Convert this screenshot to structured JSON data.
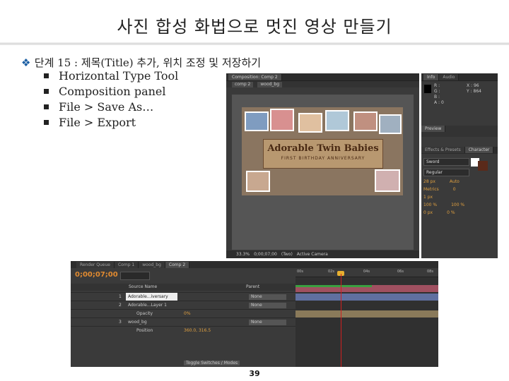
{
  "slide": {
    "title": "사진 합성 화법으로 멋진 영상 만들기",
    "step": "단계 15 : 제목(Title) 추가, 위치 조정 및 저장하기",
    "bullets": [
      "Horizontal Type Tool",
      "Composition panel",
      "File > Save As…",
      "File > Export"
    ],
    "page_number": "39"
  },
  "composition_panel": {
    "tab": "Composition: Comp 2",
    "crumbs": [
      "comp 2",
      "wood_bg"
    ],
    "canvas_title": "Adorable Twin Babies",
    "canvas_subtitle": "FIRST BIRTHDAY ANNIVERSARY",
    "zoom": "33.3%",
    "timecode": "0;00;07;00",
    "resolution": "(Two)",
    "camera": "Active Camera"
  },
  "info_panel": {
    "tabs": [
      "Info",
      "Audio"
    ],
    "rgba": [
      "R :",
      "G :",
      "B :",
      "A : 0"
    ],
    "xy": [
      "X : 96",
      "Y : 864"
    ],
    "preview_tab": "Preview",
    "effects_tab": "Effects & Presets",
    "character_tab": "Character",
    "font": "Sword",
    "style": "Regular",
    "size": "28 px",
    "tracking_value": "0",
    "auto": "Auto",
    "metric": "Metrics",
    "stroke": "1 px",
    "scale_v": "100 %",
    "scale_h": "100 %",
    "baseline": "0 px",
    "tsume": "0 %"
  },
  "timeline": {
    "tabs": [
      "Render Queue",
      "Comp 1",
      "wood_bg",
      "Comp 2"
    ],
    "timecode": "0;00;07;00",
    "header_name": "Source Name",
    "header_parent": "Parent",
    "layers": [
      {
        "num": "1",
        "name": "Adorable...iversary",
        "mode": "None"
      },
      {
        "num": "2",
        "name": "Adorable...Layer 1",
        "mode": "None"
      },
      {
        "num": "",
        "name": "Opacity",
        "val": "0%"
      },
      {
        "num": "3",
        "name": "wood_bg",
        "mode": "None"
      },
      {
        "num": "",
        "name": "Position",
        "val": "360.0, 316.5"
      }
    ],
    "ruler": [
      "00s",
      "02s",
      "04s",
      "06s",
      "08s"
    ],
    "toggle_label": "Toggle Switches / Modes"
  },
  "colors": {
    "ae_bg": "#3a3a3a",
    "timecode": "#e08a30",
    "playhead": "#d02020",
    "track_green": "#3aa040",
    "track_red": "#a05060",
    "track_blue": "#6070a0"
  }
}
